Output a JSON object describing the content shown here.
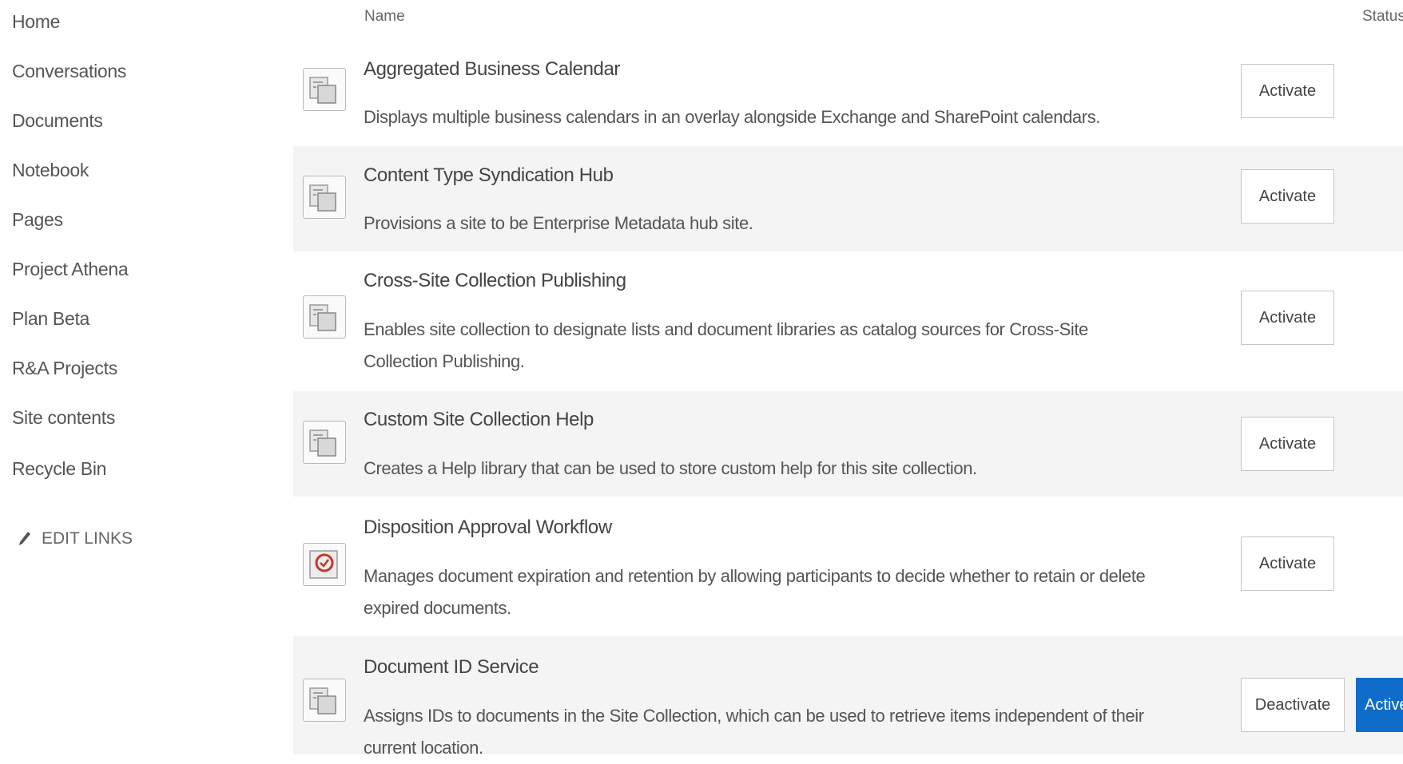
{
  "sidebar": {
    "items": [
      {
        "label": "Home"
      },
      {
        "label": "Conversations"
      },
      {
        "label": "Documents"
      },
      {
        "label": "Notebook"
      },
      {
        "label": "Pages"
      },
      {
        "label": "Project Athena"
      },
      {
        "label": "Plan Beta"
      },
      {
        "label": "R&A Projects"
      },
      {
        "label": "Site contents"
      },
      {
        "label": "Recycle Bin"
      }
    ],
    "edit_links": "EDIT LINKS"
  },
  "columns": {
    "name": "Name",
    "status": "Status"
  },
  "features": [
    {
      "title": "Aggregated Business Calendar",
      "description": "Displays multiple business calendars in an overlay alongside Exchange and SharePoint calendars.",
      "icon": "feature-icon",
      "action": "Activate"
    },
    {
      "title": "Content Type Syndication Hub",
      "description": "Provisions a site to be Enterprise Metadata hub site.",
      "icon": "feature-icon",
      "action": "Activate"
    },
    {
      "title": "Cross-Site Collection Publishing",
      "description": "Enables site collection to designate lists and document libraries as catalog sources for Cross-Site Collection Publishing.",
      "icon": "feature-icon",
      "action": "Activate"
    },
    {
      "title": "Custom Site Collection Help",
      "description": "Creates a Help library that can be used to store custom help for this site collection.",
      "icon": "feature-icon",
      "action": "Activate"
    },
    {
      "title": "Disposition Approval Workflow",
      "description": "Manages document expiration and retention by allowing participants to decide whether to retain or delete expired documents.",
      "icon": "workflow-icon",
      "action": "Activate"
    },
    {
      "title": "Document ID Service",
      "description": "Assigns IDs to documents in the Site Collection, which can be used to retrieve items independent of their current location.",
      "icon": "feature-icon",
      "action": "Deactivate",
      "status": "Active"
    }
  ],
  "colors": {
    "accent": "#0f6cc9",
    "row_shade": "#f4f4f4",
    "text": "#444444"
  }
}
